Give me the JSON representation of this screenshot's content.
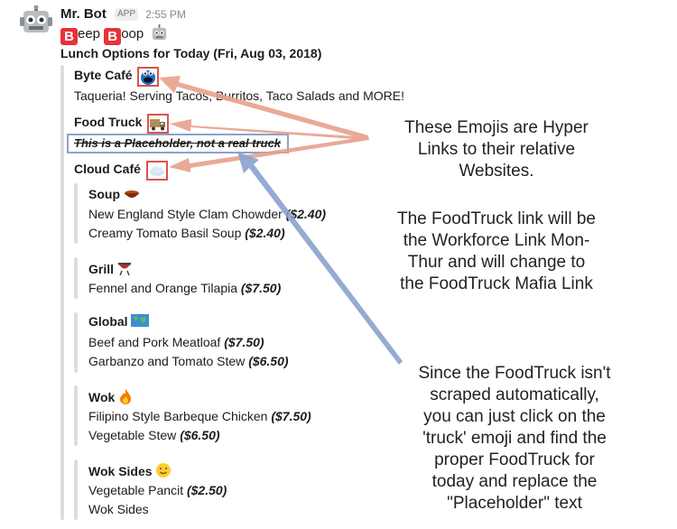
{
  "message": {
    "sender": "Mr. Bot",
    "badge": "APP",
    "time": "2:55 PM",
    "greeting": {
      "b1": "B",
      "t1": "eep ",
      "b2": "B",
      "t2": "oop"
    },
    "title": "Lunch Options for Today (Fri, Aug 03, 2018)"
  },
  "cafes": {
    "byte": {
      "name": "Byte Café",
      "desc": "Taqueria! Serving Tacos, Burritos, Taco Salads and MORE!"
    },
    "truck": {
      "name": "Food Truck",
      "desc": "This is a Placeholder, not a real truck"
    },
    "cloud": {
      "name": "Cloud Café"
    }
  },
  "sections": {
    "soup": {
      "title": "Soup",
      "items": [
        {
          "name": "New England Style Clam Chowder",
          "price": "($2.40)"
        },
        {
          "name": "Creamy Tomato Basil Soup",
          "price": "($2.40)"
        }
      ]
    },
    "grill": {
      "title": "Grill",
      "items": [
        {
          "name": "Fennel and Orange Tilapia",
          "price": "($7.50)"
        }
      ]
    },
    "global": {
      "title": "Global",
      "items": [
        {
          "name": "Beef and Pork Meatloaf",
          "price": "($7.50)"
        },
        {
          "name": "Garbanzo and Tomato Stew",
          "price": "($6.50)"
        }
      ]
    },
    "wok": {
      "title": "Wok",
      "items": [
        {
          "name": "Filipino Style Barbeque Chicken",
          "price": "($7.50)"
        },
        {
          "name": "Vegetable Stew",
          "price": "($6.50)"
        }
      ]
    },
    "wok_sides": {
      "title": "Wok Sides",
      "items": [
        {
          "name": "Vegetable Pancit",
          "price": "($2.50)"
        },
        {
          "name": "Wok Sides",
          "price": ""
        }
      ]
    }
  },
  "annotations": {
    "top": [
      "These Emojis are Hyper",
      "Links to their relative",
      "Websites."
    ],
    "middle": [
      "The FoodTruck link will be",
      "the Workforce Link Mon-",
      "Thur and will change to",
      "the FoodTruck Mafia Link"
    ],
    "bottom": [
      "Since the FoodTruck isn't",
      "scraped automatically,",
      "you can just click on the",
      "'truck' emoji and find the",
      "proper FoodTruck for",
      "today and replace the",
      "\"Placeholder\" text"
    ]
  },
  "icons": {
    "avatar": "robot-icon",
    "byte": "cookie-monster-icon",
    "truck": "truck-icon",
    "cloud": "cloud-icon",
    "soup": "soup-bowl-icon",
    "grill": "grill-icon",
    "global": "world-map-icon",
    "wok": "fire-icon",
    "wok_sides": "smiley-icon"
  },
  "colors": {
    "emoji_box": "#d9534f",
    "placeholder_box": "#8aa2cf",
    "red_arrow": "#e8a08c",
    "blue_arrow": "#8aa2cf"
  }
}
